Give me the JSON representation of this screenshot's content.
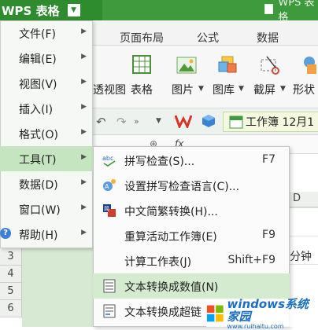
{
  "app": {
    "name": "WPS 表格",
    "doc_title": "WPS 表格"
  },
  "ribbon": {
    "tabs": [
      "页面布局",
      "公式",
      "数据"
    ],
    "buttons": [
      "透视图",
      "表格",
      "图片",
      "图库",
      "截屏",
      "形状"
    ],
    "doc_tab": "工作簿 12月1"
  },
  "grid": {
    "rows": [
      "3",
      "4",
      "5",
      "6"
    ],
    "col_header": "D",
    "cell_text": "分钟"
  },
  "main_menu": {
    "items": [
      {
        "label": "文件(F)"
      },
      {
        "label": "编辑(E)"
      },
      {
        "label": "视图(V)"
      },
      {
        "label": "插入(I)"
      },
      {
        "label": "格式(O)"
      },
      {
        "label": "工具(T)"
      },
      {
        "label": "数据(D)"
      },
      {
        "label": "窗口(W)"
      },
      {
        "label": "帮助(H)"
      }
    ],
    "active_index": 5
  },
  "tools_menu": {
    "items": [
      {
        "label": "拼写检查(S)...",
        "shortcut": "F7",
        "icon": "spellcheck-icon"
      },
      {
        "label": "设置拼写检查语言(C)...",
        "shortcut": "",
        "icon": "language-icon"
      },
      {
        "label": "中文简繁转换(H)...",
        "shortcut": "",
        "icon": "chinese-convert-icon"
      },
      {
        "label": "重算活动工作簿(E)",
        "shortcut": "F9",
        "icon": ""
      },
      {
        "label": "计算工作表(J)",
        "shortcut": "Shift+F9",
        "icon": ""
      },
      {
        "label": "文本转换成数值(N)",
        "shortcut": "",
        "icon": "text-to-number-icon"
      },
      {
        "label": "文本转换成超链",
        "shortcut": "",
        "icon": "text-to-link-icon"
      }
    ],
    "highlighted_index": 5
  },
  "watermark": {
    "title": "windows系统家园",
    "subtitle": "www.ruihaitu.com"
  },
  "colors": {
    "accent": "#2e8b2e",
    "highlight": "#d4ebd0",
    "active": "#c5e4c0"
  }
}
